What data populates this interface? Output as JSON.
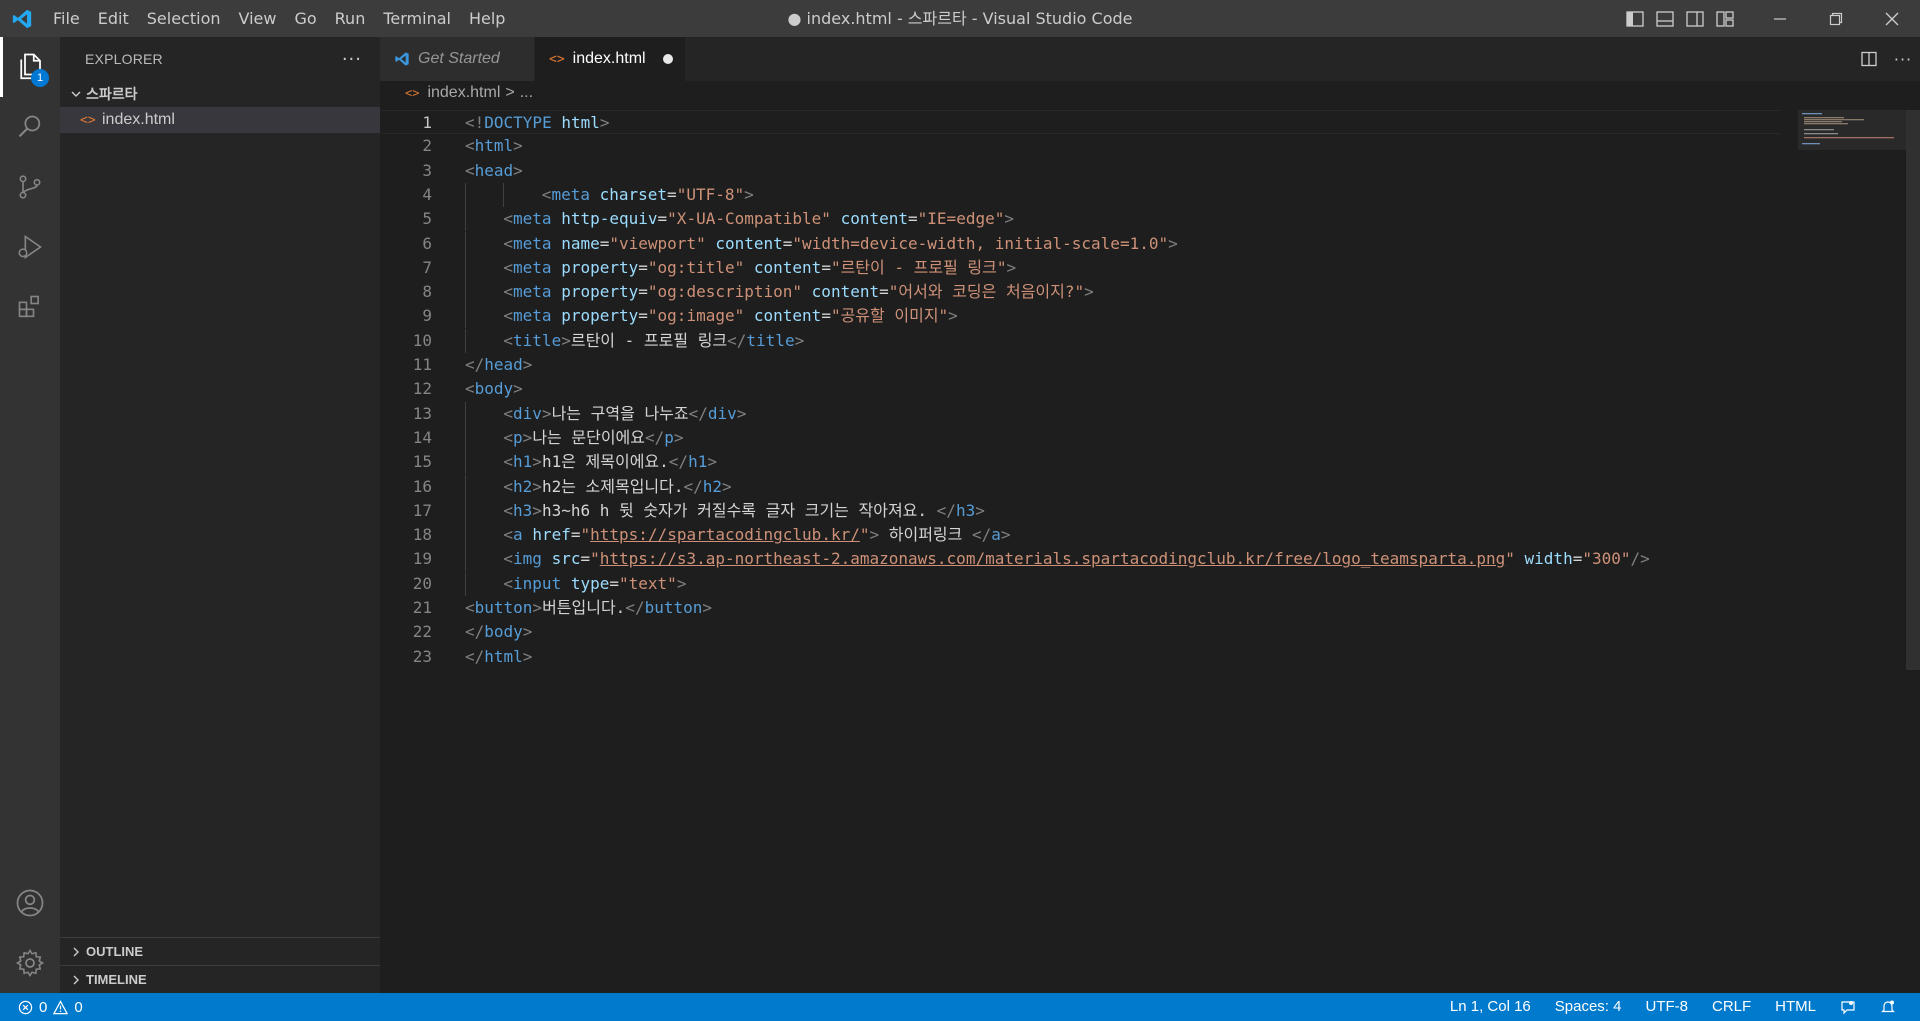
{
  "window": {
    "title": "● index.html - 스파르타 - Visual Studio Code",
    "menu": [
      "File",
      "Edit",
      "Selection",
      "View",
      "Go",
      "Run",
      "Terminal",
      "Help"
    ]
  },
  "activity": {
    "explorer_badge": "1"
  },
  "sidebar": {
    "title": "EXPLORER",
    "more": "···",
    "folder": "스파르타",
    "files": [
      {
        "name": "index.html",
        "icon": "<>"
      }
    ],
    "sections": [
      "OUTLINE",
      "TIMELINE"
    ]
  },
  "tabs": [
    {
      "label": "Get Started",
      "active": false
    },
    {
      "label": "index.html",
      "active": true,
      "dirty": true,
      "icon": "<>"
    }
  ],
  "breadcrumb": {
    "icon": "<>",
    "file": "index.html",
    "separator": ">",
    "rest": "..."
  },
  "editor": {
    "lines": [
      {
        "n": "1",
        "indent": 0,
        "tokens": [
          [
            "p",
            "<!"
          ],
          [
            "t",
            "DOCTYPE"
          ],
          [
            "x",
            " "
          ],
          [
            "a",
            "html"
          ],
          [
            "p",
            ">"
          ]
        ]
      },
      {
        "n": "2",
        "indent": 0,
        "tokens": [
          [
            "p",
            "<"
          ],
          [
            "t",
            "html"
          ],
          [
            "p",
            ">"
          ]
        ]
      },
      {
        "n": "3",
        "indent": 0,
        "tokens": [
          [
            "p",
            "<"
          ],
          [
            "t",
            "head"
          ],
          [
            "p",
            ">"
          ]
        ]
      },
      {
        "n": "4",
        "indent": 8,
        "tokens": [
          [
            "p",
            "<"
          ],
          [
            "t",
            "meta"
          ],
          [
            "x",
            " "
          ],
          [
            "a",
            "charset"
          ],
          [
            "x",
            "="
          ],
          [
            "s",
            "\"UTF-8\""
          ],
          [
            "p",
            ">"
          ]
        ]
      },
      {
        "n": "5",
        "indent": 4,
        "tokens": [
          [
            "p",
            "<"
          ],
          [
            "t",
            "meta"
          ],
          [
            "x",
            " "
          ],
          [
            "a",
            "http-equiv"
          ],
          [
            "x",
            "="
          ],
          [
            "s",
            "\"X-UA-Compatible\""
          ],
          [
            "x",
            " "
          ],
          [
            "a",
            "content"
          ],
          [
            "x",
            "="
          ],
          [
            "s",
            "\"IE=edge\""
          ],
          [
            "p",
            ">"
          ]
        ]
      },
      {
        "n": "6",
        "indent": 4,
        "tokens": [
          [
            "p",
            "<"
          ],
          [
            "t",
            "meta"
          ],
          [
            "x",
            " "
          ],
          [
            "a",
            "name"
          ],
          [
            "x",
            "="
          ],
          [
            "s",
            "\"viewport\""
          ],
          [
            "x",
            " "
          ],
          [
            "a",
            "content"
          ],
          [
            "x",
            "="
          ],
          [
            "s",
            "\"width=device-width, initial-scale=1.0\""
          ],
          [
            "p",
            ">"
          ]
        ]
      },
      {
        "n": "7",
        "indent": 4,
        "tokens": [
          [
            "p",
            "<"
          ],
          [
            "t",
            "meta"
          ],
          [
            "x",
            " "
          ],
          [
            "a",
            "property"
          ],
          [
            "x",
            "="
          ],
          [
            "s",
            "\"og:title\""
          ],
          [
            "x",
            " "
          ],
          [
            "a",
            "content"
          ],
          [
            "x",
            "="
          ],
          [
            "s",
            "\"르탄이 - 프로필 링크\""
          ],
          [
            "p",
            ">"
          ]
        ]
      },
      {
        "n": "8",
        "indent": 4,
        "tokens": [
          [
            "p",
            "<"
          ],
          [
            "t",
            "meta"
          ],
          [
            "x",
            " "
          ],
          [
            "a",
            "property"
          ],
          [
            "x",
            "="
          ],
          [
            "s",
            "\"og:description\""
          ],
          [
            "x",
            " "
          ],
          [
            "a",
            "content"
          ],
          [
            "x",
            "="
          ],
          [
            "s",
            "\"어서와 코딩은 처음이지?\""
          ],
          [
            "p",
            ">"
          ]
        ]
      },
      {
        "n": "9",
        "indent": 4,
        "tokens": [
          [
            "p",
            "<"
          ],
          [
            "t",
            "meta"
          ],
          [
            "x",
            " "
          ],
          [
            "a",
            "property"
          ],
          [
            "x",
            "="
          ],
          [
            "s",
            "\"og:image\""
          ],
          [
            "x",
            " "
          ],
          [
            "a",
            "content"
          ],
          [
            "x",
            "="
          ],
          [
            "s",
            "\"공유할 이미지\""
          ],
          [
            "p",
            ">"
          ]
        ]
      },
      {
        "n": "10",
        "indent": 4,
        "tokens": [
          [
            "p",
            "<"
          ],
          [
            "t",
            "title"
          ],
          [
            "p",
            ">"
          ],
          [
            "x",
            "르탄이 - 프로필 링크"
          ],
          [
            "p",
            "</"
          ],
          [
            "t",
            "title"
          ],
          [
            "p",
            ">"
          ]
        ]
      },
      {
        "n": "11",
        "indent": 0,
        "tokens": [
          [
            "p",
            "</"
          ],
          [
            "t",
            "head"
          ],
          [
            "p",
            ">"
          ]
        ]
      },
      {
        "n": "12",
        "indent": 0,
        "tokens": [
          [
            "p",
            "<"
          ],
          [
            "t",
            "body"
          ],
          [
            "p",
            ">"
          ]
        ]
      },
      {
        "n": "13",
        "indent": 4,
        "tokens": [
          [
            "p",
            "<"
          ],
          [
            "t",
            "div"
          ],
          [
            "p",
            ">"
          ],
          [
            "x",
            "나는 구역을 나누죠"
          ],
          [
            "p",
            "</"
          ],
          [
            "t",
            "div"
          ],
          [
            "p",
            ">"
          ]
        ]
      },
      {
        "n": "14",
        "indent": 4,
        "tokens": [
          [
            "p",
            "<"
          ],
          [
            "t",
            "p"
          ],
          [
            "p",
            ">"
          ],
          [
            "x",
            "나는 문단이에요"
          ],
          [
            "p",
            "</"
          ],
          [
            "t",
            "p"
          ],
          [
            "p",
            ">"
          ]
        ]
      },
      {
        "n": "15",
        "indent": 4,
        "tokens": [
          [
            "p",
            "<"
          ],
          [
            "t",
            "h1"
          ],
          [
            "p",
            ">"
          ],
          [
            "x",
            "h1은 제목이에요."
          ],
          [
            "p",
            "</"
          ],
          [
            "t",
            "h1"
          ],
          [
            "p",
            ">"
          ]
        ]
      },
      {
        "n": "16",
        "indent": 4,
        "tokens": [
          [
            "p",
            "<"
          ],
          [
            "t",
            "h2"
          ],
          [
            "p",
            ">"
          ],
          [
            "x",
            "h2는 소제목입니다."
          ],
          [
            "p",
            "</"
          ],
          [
            "t",
            "h2"
          ],
          [
            "p",
            ">"
          ]
        ]
      },
      {
        "n": "17",
        "indent": 4,
        "tokens": [
          [
            "p",
            "<"
          ],
          [
            "t",
            "h3"
          ],
          [
            "p",
            ">"
          ],
          [
            "x",
            "h3~h6 h 뒷 숫자가 커질수록 글자 크기는 작아져요. "
          ],
          [
            "p",
            "</"
          ],
          [
            "t",
            "h3"
          ],
          [
            "p",
            ">"
          ]
        ]
      },
      {
        "n": "18",
        "indent": 4,
        "tokens": [
          [
            "p",
            "<"
          ],
          [
            "t",
            "a"
          ],
          [
            "x",
            " "
          ],
          [
            "a",
            "href"
          ],
          [
            "x",
            "="
          ],
          [
            "s",
            "\""
          ],
          [
            "u",
            "https://spartacodingclub.kr/"
          ],
          [
            "s",
            "\""
          ],
          [
            "p",
            ">"
          ],
          [
            "x",
            " 하이퍼링크 "
          ],
          [
            "p",
            "</"
          ],
          [
            "t",
            "a"
          ],
          [
            "p",
            ">"
          ]
        ]
      },
      {
        "n": "19",
        "indent": 4,
        "tokens": [
          [
            "p",
            "<"
          ],
          [
            "t",
            "img"
          ],
          [
            "x",
            " "
          ],
          [
            "a",
            "src"
          ],
          [
            "x",
            "="
          ],
          [
            "s",
            "\""
          ],
          [
            "u",
            "https://s3.ap-northeast-2.amazonaws.com/materials.spartacodingclub.kr/free/logo_teamsparta.png"
          ],
          [
            "s",
            "\""
          ],
          [
            "x",
            " "
          ],
          [
            "a",
            "width"
          ],
          [
            "x",
            "="
          ],
          [
            "s",
            "\"300\""
          ],
          [
            "p",
            "/>"
          ]
        ]
      },
      {
        "n": "20",
        "indent": 4,
        "tokens": [
          [
            "p",
            "<"
          ],
          [
            "t",
            "input"
          ],
          [
            "x",
            " "
          ],
          [
            "a",
            "type"
          ],
          [
            "x",
            "="
          ],
          [
            "s",
            "\"text\""
          ],
          [
            "p",
            ">"
          ]
        ]
      },
      {
        "n": "21",
        "indent": 0,
        "tokens": [
          [
            "p",
            "<"
          ],
          [
            "t",
            "button"
          ],
          [
            "p",
            ">"
          ],
          [
            "x",
            "버튼입니다."
          ],
          [
            "p",
            "</"
          ],
          [
            "t",
            "button"
          ],
          [
            "p",
            ">"
          ]
        ]
      },
      {
        "n": "22",
        "indent": 0,
        "tokens": [
          [
            "p",
            "</"
          ],
          [
            "t",
            "body"
          ],
          [
            "p",
            ">"
          ]
        ]
      },
      {
        "n": "23",
        "indent": 0,
        "tokens": [
          [
            "p",
            "</"
          ],
          [
            "t",
            "html"
          ],
          [
            "p",
            ">"
          ]
        ]
      }
    ]
  },
  "status": {
    "errors": "0",
    "warnings": "0",
    "position": "Ln 1, Col 16",
    "spaces": "Spaces: 4",
    "encoding": "UTF-8",
    "eol": "CRLF",
    "language": "HTML"
  },
  "colors": {
    "accent": "#007acc",
    "tag": "#569cd6",
    "attribute": "#9cdcfe",
    "string": "#ce9178",
    "html_icon": "#e37933"
  }
}
